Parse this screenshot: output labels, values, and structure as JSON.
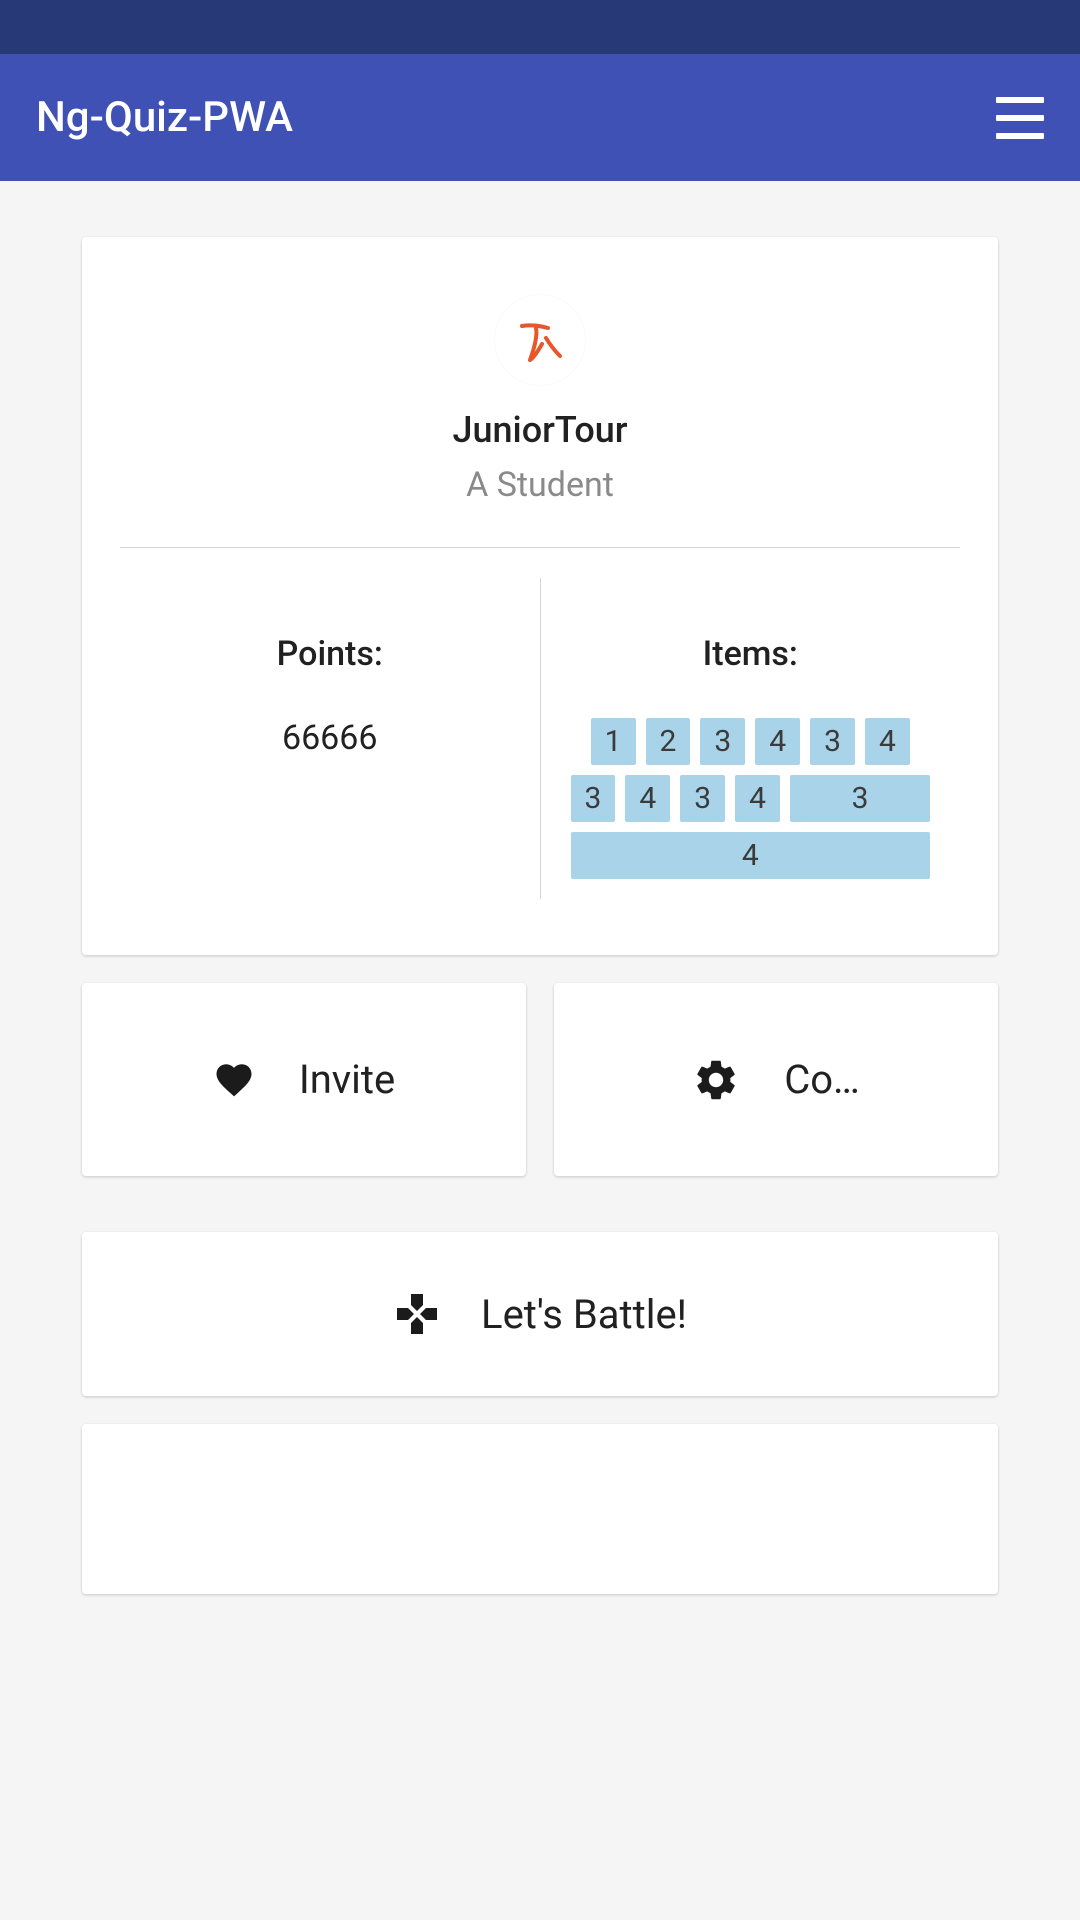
{
  "header": {
    "title": "Ng-Quiz-PWA"
  },
  "profile": {
    "username": "JuniorTour",
    "subtitle": "A Student",
    "avatar_glyph": "少"
  },
  "stats": {
    "points_label": "Points:",
    "points_value": "66666",
    "items_label": "Items:",
    "items": [
      "1",
      "2",
      "3",
      "4",
      "3",
      "4",
      "3",
      "4",
      "3",
      "4",
      "3",
      "4"
    ]
  },
  "actions": {
    "invite_label": "Invite",
    "config_label": "Co…",
    "battle_label": "Let's Battle!"
  },
  "colors": {
    "primary": "#3f51b5",
    "primary_dark": "#283977",
    "chip_bg": "#a9d3e8",
    "avatar_accent": "#e8562a"
  }
}
